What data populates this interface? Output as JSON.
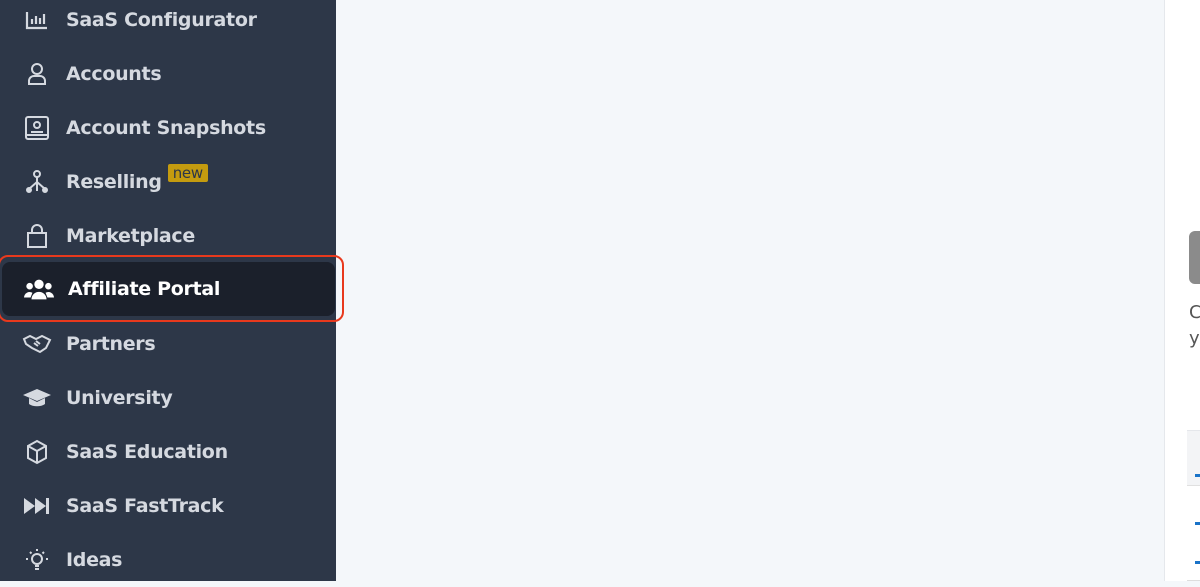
{
  "sidebar": {
    "items": [
      {
        "label": "SaaS Configurator",
        "icon": "bar-chart-icon"
      },
      {
        "label": "Accounts",
        "icon": "user-icon"
      },
      {
        "label": "Account Snapshots",
        "icon": "snapshot-icon"
      },
      {
        "label": "Reselling",
        "icon": "network-icon",
        "badge": "new"
      },
      {
        "label": "Marketplace",
        "icon": "shopping-bag-icon"
      },
      {
        "label": "Affiliate Portal",
        "icon": "users-icon",
        "active": true
      },
      {
        "label": "Partners",
        "icon": "handshake-icon"
      },
      {
        "label": "University",
        "icon": "graduation-cap-icon"
      },
      {
        "label": "SaaS Education",
        "icon": "cube-icon"
      },
      {
        "label": "SaaS FastTrack",
        "icon": "fast-forward-icon"
      },
      {
        "label": "Ideas",
        "icon": "lightbulb-icon"
      }
    ]
  },
  "panel": {
    "text_line1": "C",
    "text_line2": "yo"
  },
  "colors": {
    "sidebar": "#2d3748",
    "active": "#1b202b",
    "highlight": "#e8391d",
    "badge": "#c49b0f"
  }
}
